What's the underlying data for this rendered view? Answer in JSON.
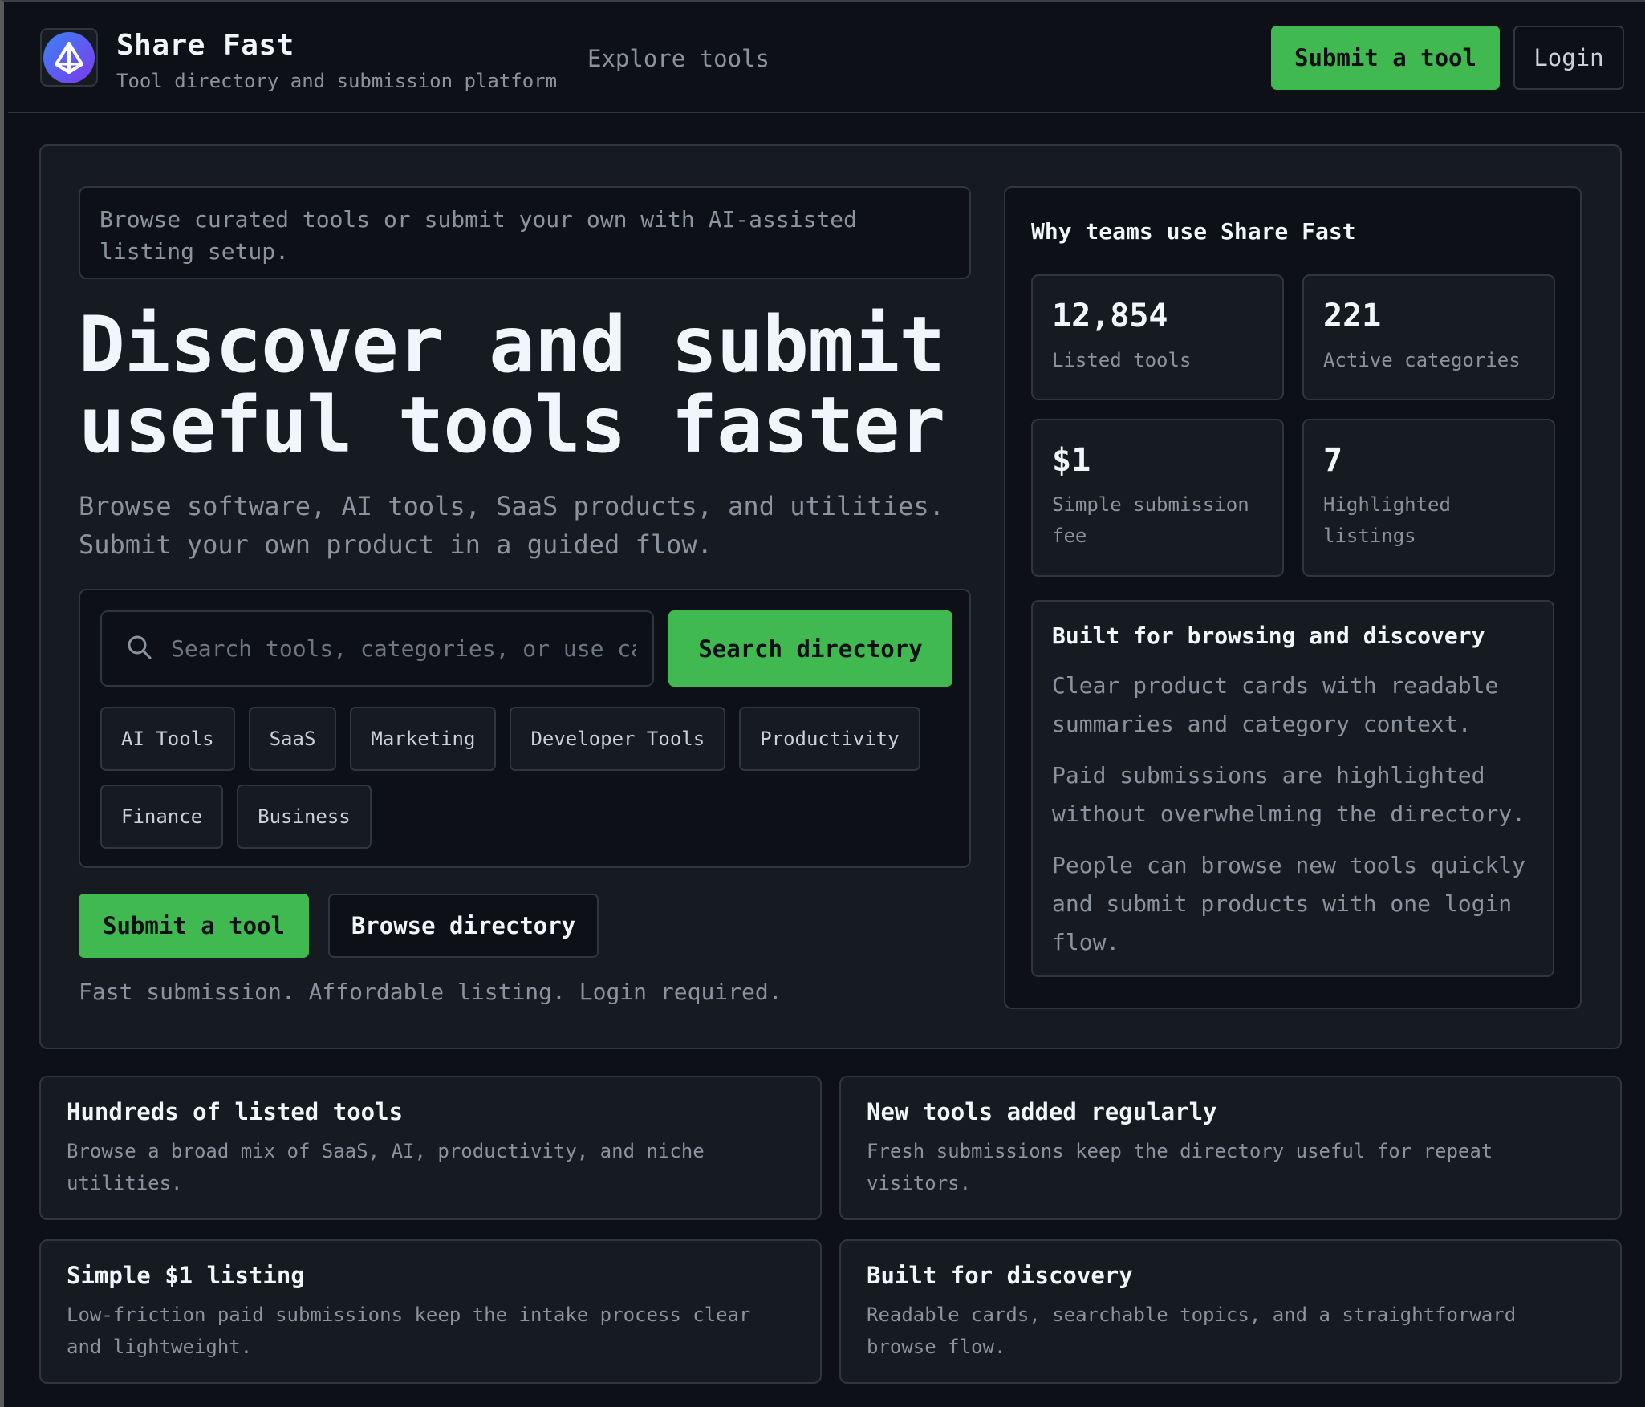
{
  "header": {
    "brand_title": "Share Fast",
    "brand_subtitle": "Tool directory and submission platform",
    "nav_explore": "Explore tools",
    "submit_label": "Submit a tool",
    "login_label": "Login"
  },
  "hero": {
    "intro": "Browse curated tools or submit your own with AI-assisted listing setup.",
    "title_line1": "Discover and submit",
    "title_line2": "useful tools faster",
    "subtitle": "Browse software, AI tools, SaaS products, and utilities. Submit your own product in a guided flow.",
    "search": {
      "placeholder": "Search tools, categories, or use cases",
      "button_label": "Search directory"
    },
    "categories": [
      "AI Tools",
      "SaaS",
      "Marketing",
      "Developer Tools",
      "Productivity",
      "Finance",
      "Business"
    ],
    "cta_submit": "Submit a tool",
    "cta_browse": "Browse directory",
    "tagline": "Fast submission. Affordable listing. Login required."
  },
  "side": {
    "title": "Why teams use Share Fast",
    "stats": [
      {
        "value": "12,854",
        "label": "Listed tools"
      },
      {
        "value": "221",
        "label": "Active categories"
      },
      {
        "value": "$1",
        "label": "Simple submission fee"
      },
      {
        "value": "7",
        "label": "Highlighted listings"
      }
    ],
    "feature": {
      "title": "Built for browsing and discovery",
      "paragraphs": [
        "Clear product cards with readable summaries and category context.",
        "Paid submissions are highlighted without overwhelming the directory.",
        "People can browse new tools quickly and submit products with one login flow."
      ]
    }
  },
  "cards": [
    {
      "title": "Hundreds of listed tools",
      "desc": "Browse a broad mix of SaaS, AI, productivity, and niche utilities."
    },
    {
      "title": "New tools added regularly",
      "desc": "Fresh submissions keep the directory useful for repeat visitors."
    },
    {
      "title": "Simple $1 listing",
      "desc": "Low-friction paid submissions keep the intake process clear and lightweight."
    },
    {
      "title": "Built for discovery",
      "desc": "Readable cards, searchable topics, and a straightforward browse flow."
    }
  ],
  "colors": {
    "accent": "#3fb950",
    "background": "#0d1117",
    "panel": "#161b22",
    "border": "#30363d",
    "logo_gradient_start": "#3b82f6",
    "logo_gradient_end": "#7c3aed"
  },
  "icons": {
    "logo": "share-fast-logo-icon",
    "search": "search-icon"
  }
}
